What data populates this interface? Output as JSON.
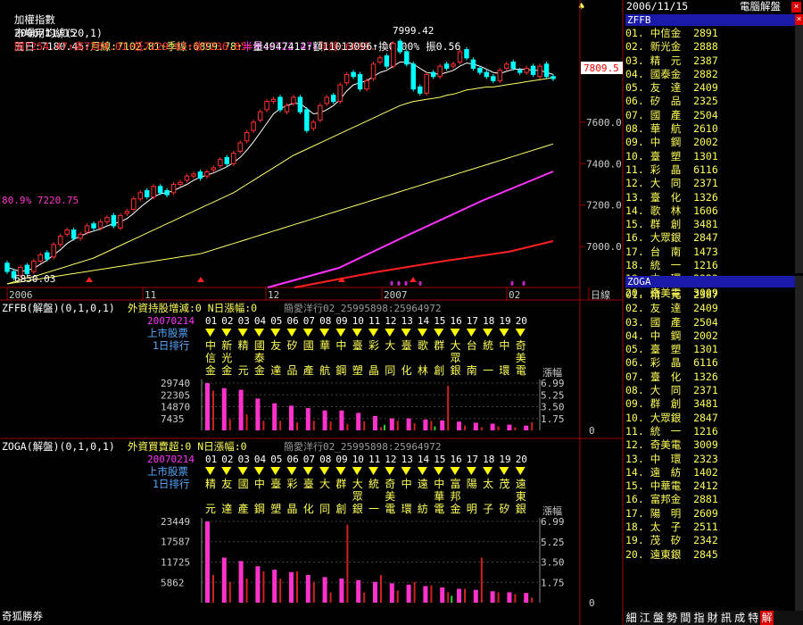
{
  "header": {
    "index_name": "加權指數",
    "ma_label": "市場用均線(20,1)",
    "ma5": "五日:7180.45↑",
    "ma_month": "月線:7102.81↑",
    "ma_quarter": "季線:6899.78↑",
    "ma_half": "半年:6722.47↑",
    "ma_year": "年線:6699.",
    "date": "2006/11/15",
    "open": "開7254.47↑",
    "high": "高7269.01↑",
    "low": "低7229.02↑",
    "close": "收7236.85↑",
    "volume": "量4947412↑",
    "amount": "額11013096↑",
    "turnover": "換0.00%",
    "amplitude": "振0.56",
    "top_right_date": "2006/11/15",
    "top_right_title": "電腦解盤",
    "bottom_left": "奇狐勝券"
  },
  "colors": {
    "up": "#ff3030",
    "down": "#00ffff",
    "ma5": "#ffffff",
    "ma20": "#ffff66",
    "ma60": "#ffff66",
    "ma120": "#ff33ff",
    "ma240": "#ff2020",
    "bar_pink": "#ff33cc",
    "bar_red": "#d02020",
    "bar_green": "#33cc33",
    "panel_blue": "#1a1aa8",
    "yellow": "#ffff55"
  },
  "chart_data": [
    {
      "type": "candlestick",
      "title": "加權指數",
      "x_ticks": [
        "2006",
        "11",
        "12",
        "2007",
        "02",
        "日線"
      ],
      "y_ticks": [
        7000.0,
        7200.0,
        7400.0,
        7600.0
      ],
      "ylim": [
        6820,
        8060
      ],
      "last_price": "7809.5",
      "annotations": {
        "high": "7999.42",
        "low": "6850.03",
        "left_pct": "80.9% 7220.75"
      },
      "candles_close": [
        6880,
        6850,
        6900,
        6870,
        6930,
        6960,
        6940,
        7010,
        7050,
        7080,
        7040,
        7060,
        7100,
        7090,
        7120,
        7140,
        7100,
        7150,
        7170,
        7230,
        7260,
        7240,
        7290,
        7260,
        7250,
        7300,
        7310,
        7340,
        7350,
        7330,
        7360,
        7380,
        7420,
        7400,
        7450,
        7500,
        7550,
        7600,
        7650,
        7700,
        7710,
        7660,
        7680,
        7720,
        7650,
        7560,
        7600,
        7680,
        7720,
        7700,
        7780,
        7830,
        7820,
        7760,
        7800,
        7880,
        7910,
        7870,
        7980,
        7940,
        7880,
        7760,
        7740,
        7830,
        7820,
        7870,
        7860,
        7880,
        7940,
        7910,
        7860,
        7840,
        7820,
        7800,
        7850,
        7880,
        7860,
        7840,
        7860,
        7830,
        7870,
        7820,
        7810
      ],
      "candles_open": [
        6920,
        6880,
        6860,
        6910,
        6880,
        6930,
        6970,
        6950,
        7010,
        7060,
        7080,
        7040,
        7070,
        7110,
        7090,
        7120,
        7150,
        7090,
        7160,
        7180,
        7230,
        7270,
        7240,
        7290,
        7270,
        7260,
        7300,
        7320,
        7340,
        7360,
        7340,
        7370,
        7390,
        7430,
        7400,
        7460,
        7510,
        7560,
        7610,
        7660,
        7700,
        7720,
        7650,
        7690,
        7720,
        7660,
        7570,
        7610,
        7690,
        7730,
        7700,
        7790,
        7840,
        7830,
        7760,
        7810,
        7890,
        7920,
        7870,
        7990,
        7940,
        7880,
        7770,
        7740,
        7840,
        7820,
        7880,
        7870,
        7890,
        7950,
        7900,
        7860,
        7840,
        7820,
        7800,
        7860,
        7890,
        7850,
        7840,
        7870,
        7820,
        7880,
        7820
      ],
      "series": [
        {
          "name": "五日",
          "values": [
            6900,
            6890,
            6880,
            6885,
            6895,
            6915,
            6935,
            6960,
            6985,
            7015,
            7035,
            7050,
            7065,
            7075,
            7085,
            7100,
            7110,
            7120,
            7135,
            7160,
            7190,
            7215,
            7240,
            7255,
            7260,
            7270,
            7285,
            7300,
            7320,
            7335,
            7345,
            7355,
            7370,
            7385,
            7405,
            7430,
            7465,
            7505,
            7550,
            7595,
            7640,
            7665,
            7680,
            7690,
            7690,
            7665,
            7640,
            7645,
            7660,
            7680,
            7710,
            7750,
            7780,
            7790,
            7800,
            7820,
            7840,
            7850,
            7870,
            7890,
            7890,
            7880,
            7860,
            7840,
            7835,
            7830,
            7840,
            7850,
            7870,
            7885,
            7880,
            7870,
            7855,
            7840,
            7835,
            7845,
            7855,
            7855,
            7855,
            7850,
            7850,
            7840,
            7830
          ]
        },
        {
          "name": "月線",
          "values": [
            6820,
            6830,
            6840,
            6850,
            6855,
            6865,
            6875,
            6885,
            6895,
            6905,
            6915,
            6925,
            6935,
            6945,
            6960,
            6975,
            6990,
            7005,
            7020,
            7035,
            7050,
            7065,
            7080,
            7095,
            7110,
            7125,
            7140,
            7155,
            7170,
            7185,
            7200,
            7215,
            7230,
            7245,
            7260,
            7280,
            7300,
            7320,
            7340,
            7360,
            7380,
            7400,
            7420,
            7440,
            7455,
            7470,
            7485,
            7500,
            7515,
            7530,
            7545,
            7560,
            7575,
            7590,
            7605,
            7620,
            7635,
            7650,
            7665,
            7680,
            7690,
            7700,
            7705,
            7710,
            7715,
            7720,
            7730,
            7735,
            7745,
            7755,
            7760,
            7765,
            7770,
            7770,
            7775,
            7780,
            7785,
            7790,
            7795,
            7800,
            7805,
            7810,
            7815
          ]
        },
        {
          "name": "季線",
          "values": [
            6820,
            6825,
            6830,
            6835,
            6840,
            6845,
            6850,
            6855,
            6860,
            6865,
            6870,
            6875,
            6880,
            6885,
            6890,
            6895,
            6900,
            6905,
            6910,
            6915,
            6920,
            6925,
            6930,
            6935,
            6940,
            6945,
            6950,
            6955,
            6960,
            6965,
            6975,
            6985,
            6995,
            7005,
            7015,
            7025,
            7035,
            7045,
            7055,
            7065,
            7075,
            7085,
            7095,
            7105,
            7115,
            7125,
            7135,
            7145,
            7155,
            7165,
            7175,
            7185,
            7195,
            7205,
            7215,
            7225,
            7235,
            7245,
            7255,
            7265,
            7275,
            7285,
            7295,
            7305,
            7315,
            7325,
            7335,
            7345,
            7355,
            7365,
            7375,
            7385,
            7395,
            7405,
            7415,
            7425,
            7435,
            7445,
            7455,
            7465,
            7475,
            7485,
            7495
          ]
        }
      ]
    },
    {
      "type": "bar",
      "title": "ZFFB(解盤)(0,1,0,1)",
      "subtitle": "外資持股增減:0 N日漲幅:0",
      "code_text": "簡愛洋行02_25995898:25964972",
      "date_label": "20070214",
      "row_labels": [
        "上市股票",
        "1日排行"
      ],
      "rank_numbers": [
        "01",
        "02",
        "03",
        "04",
        "05",
        "06",
        "07",
        "08",
        "09",
        "10",
        "11",
        "12",
        "13",
        "14",
        "15",
        "16",
        "17",
        "18",
        "19",
        "20"
      ],
      "stock_names": [
        [
          "中",
          "信",
          "金"
        ],
        [
          "新",
          "光",
          "金"
        ],
        [
          "精",
          "",
          "元"
        ],
        [
          "國",
          "泰",
          "金"
        ],
        [
          "友",
          "",
          "達"
        ],
        [
          "矽",
          "",
          "品"
        ],
        [
          "國",
          "",
          "產"
        ],
        [
          "華",
          "",
          "航"
        ],
        [
          "中",
          "",
          "鋼"
        ],
        [
          "臺",
          "",
          "塑"
        ],
        [
          "彩",
          "",
          "晶"
        ],
        [
          "大",
          "",
          "同"
        ],
        [
          "臺",
          "",
          "化"
        ],
        [
          "歌",
          "",
          "林"
        ],
        [
          "群",
          "",
          "創"
        ],
        [
          "大",
          "眾",
          "銀"
        ],
        [
          "台",
          "",
          "南"
        ],
        [
          "統",
          "",
          "一"
        ],
        [
          "中",
          "",
          "環"
        ],
        [
          "奇",
          "美",
          "電"
        ]
      ],
      "y_left_ticks": [
        "29740",
        "22305",
        "14870",
        "7435"
      ],
      "y_right_label": "漲幅",
      "y_right_ticks": [
        "6.99",
        "5.25",
        "3.50",
        "1.75",
        "0"
      ],
      "values_pink": [
        29740,
        26500,
        25500,
        20000,
        17000,
        15500,
        14000,
        12500,
        12500,
        11000,
        9000,
        7500,
        7500,
        6800,
        6200,
        5500,
        4800,
        4200,
        3600,
        3000
      ],
      "values_red": [
        25000,
        7000,
        10000,
        6000,
        6000,
        5000,
        6000,
        5500,
        4000,
        5500,
        2000,
        6000,
        4500,
        6000,
        28000,
        3000,
        2000,
        2500,
        2000,
        5000
      ],
      "values_green": [
        0,
        0,
        0,
        0,
        0,
        0,
        0,
        0,
        0,
        0,
        3500,
        0,
        0,
        2500,
        0,
        0,
        0,
        0,
        0,
        0
      ]
    },
    {
      "type": "bar",
      "title": "ZOGA(解盤)(0,1,0,1)",
      "subtitle": "外資買賣超:0 N日漲幅:0",
      "code_text": "簡愛洋行02_25995898:25964972",
      "date_label": "20070214",
      "row_labels": [
        "上市股票",
        "1日排行"
      ],
      "rank_numbers": [
        "01",
        "02",
        "03",
        "04",
        "05",
        "06",
        "07",
        "08",
        "09",
        "10",
        "11",
        "12",
        "13",
        "14",
        "15",
        "16",
        "17",
        "18",
        "19",
        "20"
      ],
      "stock_names": [
        [
          "精",
          "",
          "元"
        ],
        [
          "友",
          "",
          "達"
        ],
        [
          "國",
          "",
          "產"
        ],
        [
          "中",
          "",
          "鋼"
        ],
        [
          "臺",
          "",
          "塑"
        ],
        [
          "彩",
          "",
          "晶"
        ],
        [
          "臺",
          "",
          "化"
        ],
        [
          "大",
          "",
          "同"
        ],
        [
          "群",
          "",
          "創"
        ],
        [
          "大",
          "眾",
          "銀"
        ],
        [
          "統",
          "",
          "一"
        ],
        [
          "奇",
          "美",
          "電"
        ],
        [
          "中",
          "",
          "環"
        ],
        [
          "遠",
          "",
          "紡"
        ],
        [
          "中",
          "華",
          "電"
        ],
        [
          "富",
          "邦",
          "金"
        ],
        [
          "陽",
          "",
          "明"
        ],
        [
          "太",
          "",
          "子"
        ],
        [
          "茂",
          "",
          "矽"
        ],
        [
          "遠",
          "東",
          "銀"
        ]
      ],
      "y_left_ticks": [
        "23449",
        "17587",
        "11725",
        "5862"
      ],
      "y_right_label": "漲幅",
      "y_right_ticks": [
        "6.99",
        "5.25",
        "3.50",
        "1.75",
        "0"
      ],
      "values_pink": [
        23449,
        13000,
        12000,
        10500,
        9500,
        8800,
        8000,
        7400,
        7000,
        6500,
        6000,
        5600,
        5200,
        4800,
        4400,
        4000,
        3700,
        3300,
        3000,
        2800
      ],
      "values_red": [
        8000,
        6000,
        7000,
        9000,
        7000,
        9000,
        6000,
        3000,
        22500,
        3000,
        8000,
        3500,
        6000,
        5000,
        3000,
        4000,
        13000,
        3000,
        2500,
        1500
      ],
      "values_green": [
        0,
        0,
        0,
        0,
        0,
        0,
        0,
        0,
        0,
        0,
        0,
        0,
        0,
        0,
        2000,
        0,
        0,
        0,
        0,
        0
      ]
    }
  ],
  "right_panel_top": {
    "title": "ZFFB",
    "close_label": "×",
    "items": [
      {
        "no": "01.",
        "name": "中信金",
        "val": "2891"
      },
      {
        "no": "02.",
        "name": "新光金",
        "val": "2888"
      },
      {
        "no": "03.",
        "name": "精　元",
        "val": "2387"
      },
      {
        "no": "04.",
        "name": "國泰金",
        "val": "2882"
      },
      {
        "no": "05.",
        "name": "友　達",
        "val": "2409"
      },
      {
        "no": "06.",
        "name": "矽　品",
        "val": "2325"
      },
      {
        "no": "07.",
        "name": "國　產",
        "val": "2504"
      },
      {
        "no": "08.",
        "name": "華　航",
        "val": "2610"
      },
      {
        "no": "09.",
        "name": "中　鋼",
        "val": "2002"
      },
      {
        "no": "10.",
        "name": "臺　塑",
        "val": "1301"
      },
      {
        "no": "11.",
        "name": "彩　晶",
        "val": "6116"
      },
      {
        "no": "12.",
        "name": "大　同",
        "val": "2371"
      },
      {
        "no": "13.",
        "name": "臺　化",
        "val": "1326"
      },
      {
        "no": "14.",
        "name": "歌　林",
        "val": "1606"
      },
      {
        "no": "15.",
        "name": "群　創",
        "val": "3481"
      },
      {
        "no": "16.",
        "name": "大眾銀",
        "val": "2847"
      },
      {
        "no": "17.",
        "name": "台　南",
        "val": "1473"
      },
      {
        "no": "18.",
        "name": "統　一",
        "val": "1216"
      },
      {
        "no": "19.",
        "name": "中　環",
        "val": "2323"
      },
      {
        "no": "20.",
        "name": "奇美電",
        "val": "3009"
      }
    ]
  },
  "right_panel_bottom": {
    "title": "ZOGA",
    "items": [
      {
        "no": "01.",
        "name": "精　元",
        "val": "2387"
      },
      {
        "no": "02.",
        "name": "友　達",
        "val": "2409"
      },
      {
        "no": "03.",
        "name": "國　產",
        "val": "2504"
      },
      {
        "no": "04.",
        "name": "中　鋼",
        "val": "2002"
      },
      {
        "no": "05.",
        "name": "臺　塑",
        "val": "1301"
      },
      {
        "no": "06.",
        "name": "彩　晶",
        "val": "6116"
      },
      {
        "no": "07.",
        "name": "臺　化",
        "val": "1326"
      },
      {
        "no": "08.",
        "name": "大　同",
        "val": "2371"
      },
      {
        "no": "09.",
        "name": "群　創",
        "val": "3481"
      },
      {
        "no": "10.",
        "name": "大眾銀",
        "val": "2847"
      },
      {
        "no": "11.",
        "name": "統　一",
        "val": "1216"
      },
      {
        "no": "12.",
        "name": "奇美電",
        "val": "3009"
      },
      {
        "no": "13.",
        "name": "中　環",
        "val": "2323"
      },
      {
        "no": "14.",
        "name": "遠　紡",
        "val": "1402"
      },
      {
        "no": "15.",
        "name": "中華電",
        "val": "2412"
      },
      {
        "no": "16.",
        "name": "富邦金",
        "val": "2881"
      },
      {
        "no": "17.",
        "name": "陽　明",
        "val": "2609"
      },
      {
        "no": "18.",
        "name": "太　子",
        "val": "2511"
      },
      {
        "no": "19.",
        "name": "茂　矽",
        "val": "2342"
      },
      {
        "no": "20.",
        "name": "遠東銀",
        "val": "2845"
      }
    ]
  },
  "bottom_tabs": [
    "細",
    "江",
    "盤",
    "勢",
    "間",
    "指",
    "財",
    "訊",
    "成",
    "特",
    "解"
  ]
}
